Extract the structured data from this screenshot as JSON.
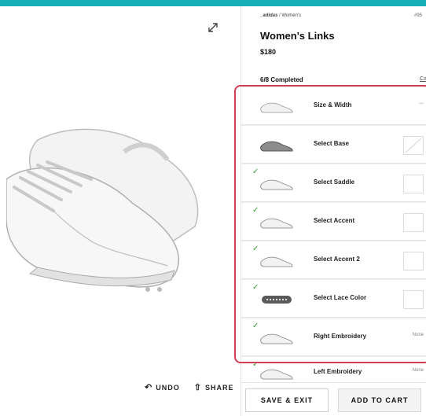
{
  "header": {
    "breadcrumb_brand": "_adidas",
    "breadcrumb_section": "/ Women's",
    "sku": "#95",
    "title": "Women's Links",
    "price": "$180",
    "progress": "6/8 Completed",
    "progress_link": "Ca"
  },
  "steps": [
    {
      "label": "Size & Width",
      "value": "—",
      "checked": false,
      "swatch": "none"
    },
    {
      "label": "Select Base",
      "value": "",
      "checked": false,
      "swatch": "slash"
    },
    {
      "label": "Select Saddle",
      "value": "",
      "checked": true,
      "swatch": "white"
    },
    {
      "label": "Select Accent",
      "value": "",
      "checked": true,
      "swatch": "white"
    },
    {
      "label": "Select Accent 2",
      "value": "",
      "checked": true,
      "swatch": "white"
    },
    {
      "label": "Select Lace Color",
      "value": "",
      "checked": true,
      "swatch": "white"
    },
    {
      "label": "Right Embroidery",
      "value": "None",
      "checked": true,
      "swatch": "none"
    },
    {
      "label": "Left Embroidery",
      "value": "None",
      "checked": true,
      "swatch": "none"
    }
  ],
  "actions": {
    "undo": "UNDO",
    "share": "SHARE"
  },
  "footer": {
    "save_exit": "SAVE & EXIT",
    "add_to_cart": "ADD TO CART"
  },
  "colors": {
    "accent": "#16aeb6",
    "highlight": "#d23d57",
    "check": "#3a9a36"
  }
}
